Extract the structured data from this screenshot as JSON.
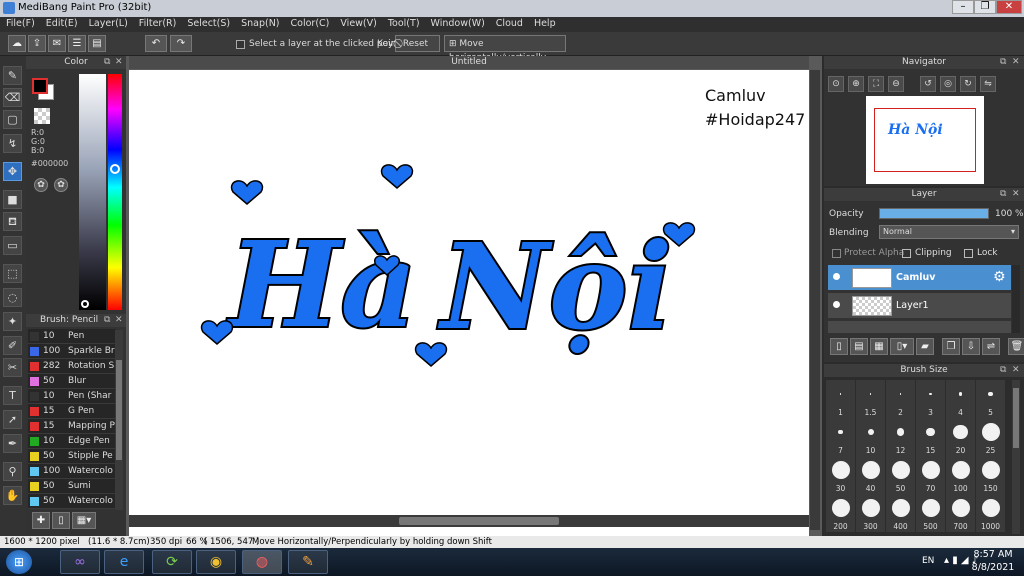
{
  "window": {
    "title": "MediBang Paint Pro (32bit)"
  },
  "menu": [
    "File(F)",
    "Edit(E)",
    "Layer(L)",
    "Filter(R)",
    "Select(S)",
    "Snap(N)",
    "Color(C)",
    "View(V)",
    "Tool(T)",
    "Window(W)",
    "Cloud",
    "Help"
  ],
  "toolbar": {
    "select_layer_label": "Select a layer at the clicked point",
    "key_label": "Key",
    "reset_label": "Reset",
    "move_label": "Move horizontally/vertically"
  },
  "color_panel": {
    "title": "Color",
    "r": "R:0",
    "g": "G:0",
    "b": "B:0",
    "hex": "#000000"
  },
  "brush_panel": {
    "title": "Brush: Pencil",
    "brushes": [
      {
        "size": "10",
        "name": "Pen",
        "color": "#333333"
      },
      {
        "size": "100",
        "name": "Sparkle Br",
        "color": "#3a66e8"
      },
      {
        "size": "282",
        "name": "Rotation S",
        "color": "#e03030"
      },
      {
        "size": "50",
        "name": "Blur",
        "color": "#e070e0"
      },
      {
        "size": "10",
        "name": "Pen (Shar",
        "color": "#333333"
      },
      {
        "size": "15",
        "name": "G Pen",
        "color": "#e03030"
      },
      {
        "size": "15",
        "name": "Mapping P",
        "color": "#e03030"
      },
      {
        "size": "10",
        "name": "Edge Pen",
        "color": "#22aa22"
      },
      {
        "size": "50",
        "name": "Stipple Pe",
        "color": "#e8d020"
      },
      {
        "size": "100",
        "name": "Watercolo",
        "color": "#60c8f0"
      },
      {
        "size": "50",
        "name": "Sumi",
        "color": "#e8d020"
      },
      {
        "size": "50",
        "name": "Watercolo",
        "color": "#60c8f0"
      }
    ]
  },
  "canvas": {
    "tab_title": "Untitled",
    "watermark_line1": "Camluv",
    "watermark_line2": "#Hoidap247",
    "art_word1": "Hà",
    "art_word2": "Nội"
  },
  "navigator": {
    "title": "Navigator"
  },
  "layer_panel": {
    "title": "Layer",
    "opacity_label": "Opacity",
    "opacity_value": "100 %",
    "opacity_fraction": 1.0,
    "blending_label": "Blending",
    "blending_value": "Normal",
    "protect_alpha": "Protect Alpha",
    "clipping": "Clipping",
    "lock": "Lock",
    "layers": [
      {
        "name": "Camluv",
        "selected": true
      },
      {
        "name": "Layer1",
        "selected": false
      }
    ]
  },
  "brush_size": {
    "title": "Brush Size",
    "sizes": [
      "1",
      "1.5",
      "2",
      "3",
      "4",
      "5",
      "7",
      "10",
      "12",
      "15",
      "20",
      "25",
      "30",
      "40",
      "50",
      "70",
      "100",
      "150",
      "200",
      "300",
      "400",
      "500",
      "700",
      "1000"
    ]
  },
  "status": {
    "dimensions": "1600 * 1200 pixel",
    "physical": "(11.6 * 8.7cm)",
    "dpi": "350 dpi",
    "zoom": "66 %",
    "coords": "( 1506, 547 )",
    "hint": "Move Horizontally/Perpendicularly by holding down Shift"
  },
  "taskbar": {
    "lang": "EN",
    "time": "8:57 AM",
    "date": "8/8/2021"
  },
  "colors": {
    "accent": "#1a6ff0",
    "selected_layer": "#4a8fd0"
  }
}
